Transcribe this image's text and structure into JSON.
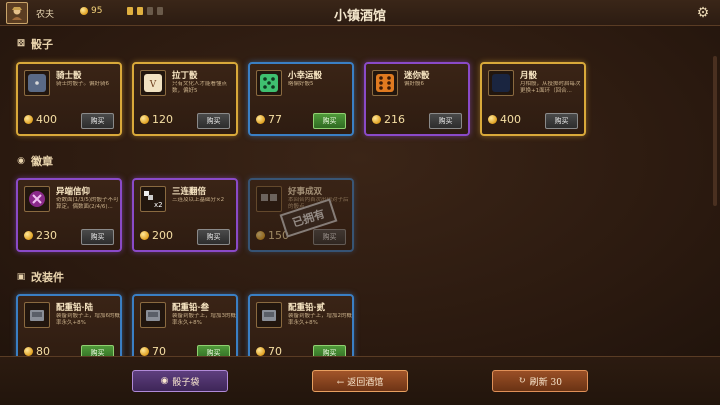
{
  "header": {
    "rank": "农夫",
    "gold": "95",
    "title": "小镇酒馆",
    "keys_colors": [
      "#e0b040",
      "#e0b040",
      "#6a5a4a",
      "#6a5a4a"
    ]
  },
  "sections": [
    {
      "title": "骰子",
      "icon": "dice-icon"
    },
    {
      "title": "徽章",
      "icon": "badge-icon"
    },
    {
      "title": "改装件",
      "icon": "mod-icon"
    }
  ],
  "dice_cards": [
    {
      "name": "骑士骰",
      "desc": "骑士的骰子。偏好骑6",
      "price": "400",
      "buy": "购买",
      "frame": "gold",
      "buy_style": "gray",
      "icon": "knight-die-icon"
    },
    {
      "name": "拉丁骰",
      "desc": "只有文化人才能看懂点数，偏好5",
      "price": "120",
      "buy": "购买",
      "frame": "gold",
      "buy_style": "gray",
      "icon": "latin-die-icon"
    },
    {
      "name": "小幸运骰",
      "desc": "略偏好骰5",
      "price": "77",
      "buy": "购买",
      "frame": "blue",
      "buy_style": "green",
      "icon": "lucky-die-icon"
    },
    {
      "name": "迷你骰",
      "desc": "偏好骰6",
      "price": "216",
      "buy": "购买",
      "frame": "purple",
      "buy_style": "gray",
      "icon": "mini-die-icon"
    },
    {
      "name": "月骰",
      "desc": "月相骰，从投掷时启每次更换+1面环（回合...",
      "price": "400",
      "buy": "购买",
      "frame": "gold",
      "buy_style": "gray",
      "icon": "moon-die-icon"
    }
  ],
  "badge_cards": [
    {
      "name": "异端信仰",
      "desc": "奇数面(1/3/5)的骰子不可算定。偶数面(2/4/6)...",
      "price": "230",
      "buy": "购买",
      "frame": "purple",
      "buy_style": "gray",
      "icon": "heresy-badge-icon"
    },
    {
      "name": "三连翻倍",
      "desc": "三连及以上基础分×2",
      "price": "200",
      "buy": "购买",
      "frame": "purple",
      "buy_style": "gray",
      "icon": "triple-badge-icon",
      "icon_label": "x2"
    },
    {
      "name": "好事成双",
      "desc": "本回合内首次出现对子后的骰点...",
      "price": "150",
      "buy": "购买",
      "frame": "blue",
      "buy_style": "gray",
      "icon": "double-badge-icon",
      "owned": true,
      "stamp": "已拥有"
    }
  ],
  "mod_cards": [
    {
      "name": "配重铅·陆",
      "desc": "装备到骰子上，增加6的概率永久+8%",
      "price": "80",
      "buy": "购买",
      "frame": "blue",
      "buy_style": "green",
      "icon": "weight-6-icon"
    },
    {
      "name": "配重铅·叁",
      "desc": "装备到骰子上，增加3的概率永久+8%",
      "price": "70",
      "buy": "购买",
      "frame": "blue",
      "buy_style": "green",
      "icon": "weight-3-icon"
    },
    {
      "name": "配重铅·贰",
      "desc": "装备到骰子上，增加2的概率永久+8%",
      "price": "70",
      "buy": "购买",
      "frame": "blue",
      "buy_style": "green",
      "icon": "weight-2-icon"
    }
  ],
  "footer": {
    "dice_bag": "骰子袋",
    "back": "← 返回酒馆",
    "refresh": "刷新 30"
  }
}
